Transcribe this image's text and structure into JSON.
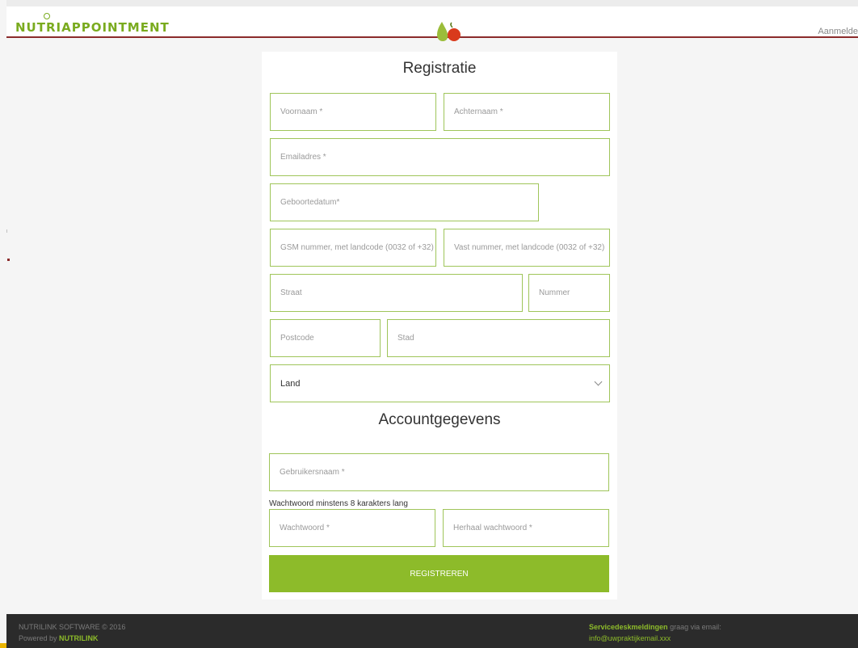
{
  "header": {
    "logo_text": "NUTRIAPPOINTMENT",
    "login_label": "Aanmelde"
  },
  "form": {
    "title": "Registratie",
    "first_name_placeholder": "Voornaam *",
    "last_name_placeholder": "Achternaam *",
    "email_placeholder": "Emailadres *",
    "birthdate_placeholder": "Geboortedatum*",
    "mobile_placeholder": "GSM nummer, met landcode (0032 of +32)",
    "landline_placeholder": "Vast nummer, met landcode (0032 of +32)",
    "street_placeholder": "Straat",
    "number_placeholder": "Nummer",
    "postcode_placeholder": "Postcode",
    "city_placeholder": "Stad",
    "country_value": "Land",
    "account_title": "Accountgegevens",
    "username_placeholder": "Gebruikersnaam *",
    "password_hint": "Wachtwoord minstens 8 karakters lang",
    "password_placeholder": "Wachtwoord *",
    "password_repeat_placeholder": "Herhaal wachtwoord *",
    "submit_label": "REGISTREREN"
  },
  "footer": {
    "copyright": "NUTRILINK SOFTWARE © 2016",
    "powered_prefix": "Powered by",
    "powered_brand": "NUTRILINK",
    "servicedesk_bold": "Servicedeskmeldingen",
    "servicedesk_rest": "graag via email:",
    "email": "info@uwpraktijkemail.xxx"
  },
  "colors": {
    "accent_green": "#8dbb2a",
    "header_border": "#8b2b2b",
    "field_border": "#9fc55a",
    "footer_bg": "#2b2b2b"
  },
  "icons": [
    "pear-apple-logo-icon",
    "chevron-down-icon"
  ]
}
